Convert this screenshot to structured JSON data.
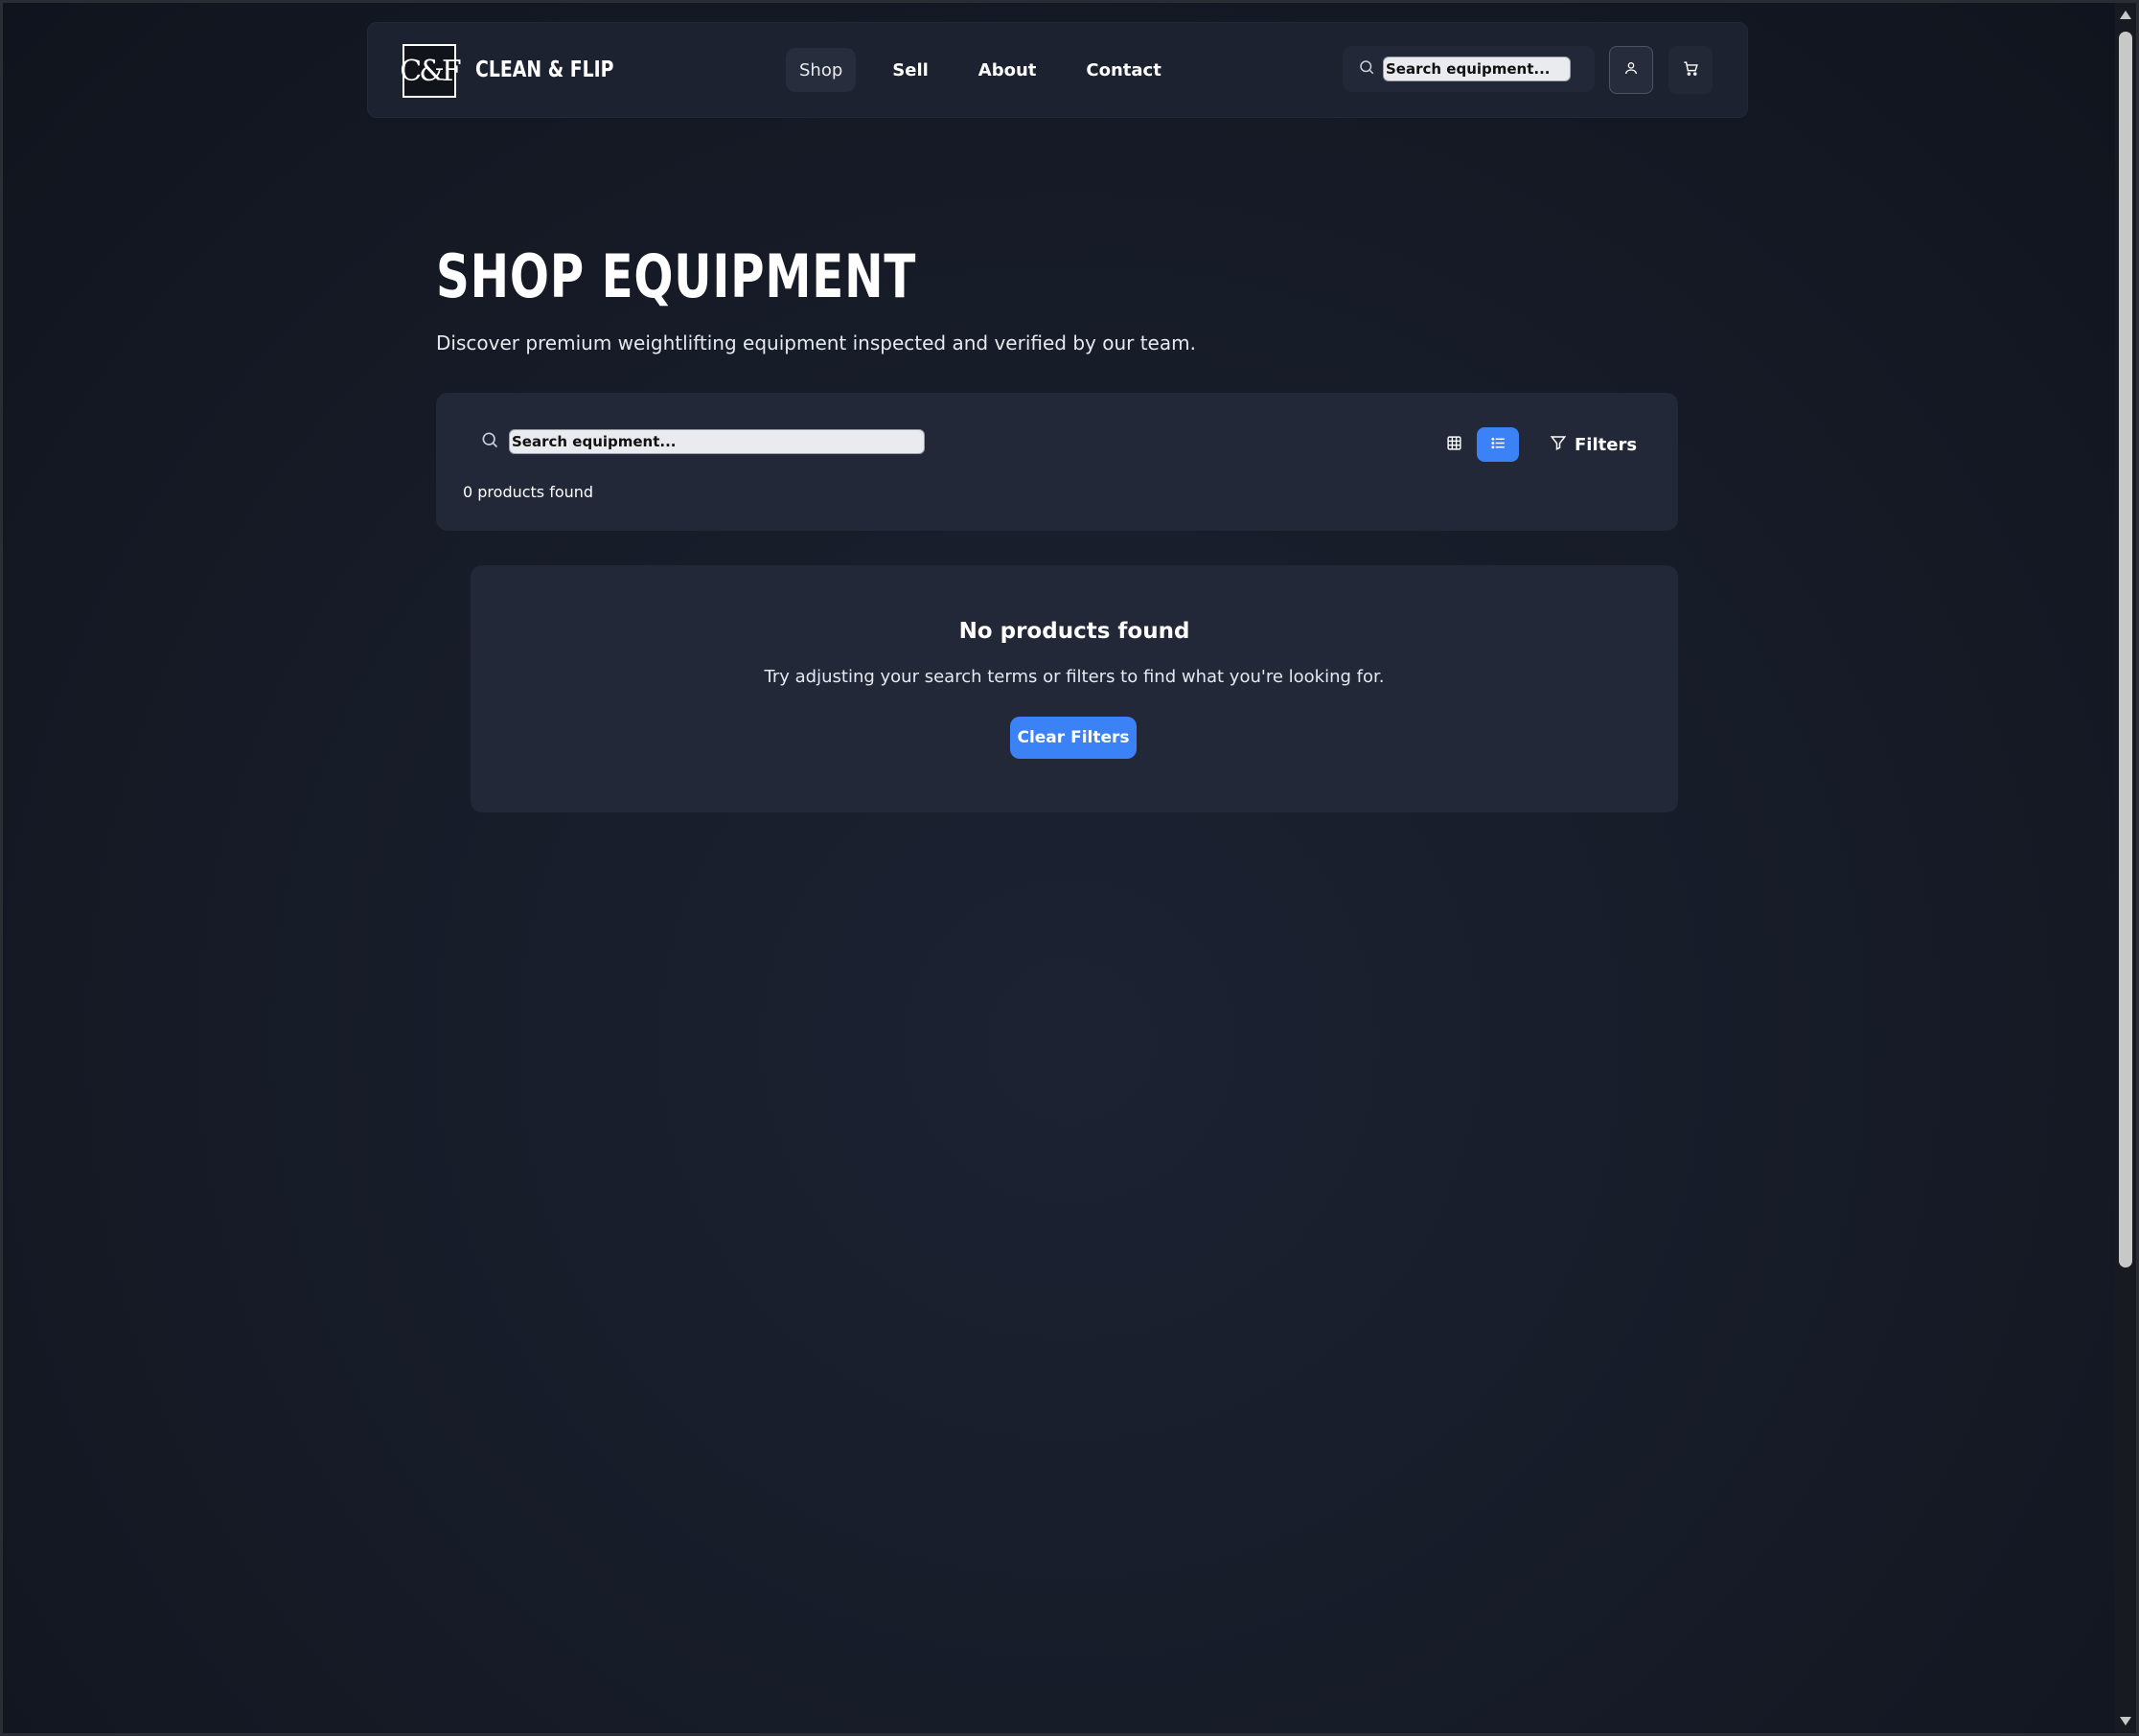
{
  "brand": {
    "logo_text": "C&F",
    "name": "CLEAN & FLIP"
  },
  "nav": {
    "items": [
      {
        "label": "Shop",
        "active": true
      },
      {
        "label": "Sell"
      },
      {
        "label": "About"
      },
      {
        "label": "Contact"
      }
    ]
  },
  "header_search": {
    "value": "Search equipment...",
    "icon": "search-icon"
  },
  "header_actions": {
    "user_icon": "user-icon",
    "cart_icon": "cart-icon"
  },
  "page": {
    "title": "SHOP EQUIPMENT",
    "subtitle": "Discover premium weightlifting equipment inspected and verified by our team."
  },
  "toolbar": {
    "search_value": "Search equipment...",
    "results_count": "0 products found",
    "view_mode": "list",
    "filters_label": "Filters"
  },
  "empty_state": {
    "title": "No products found",
    "description": "Try adjusting your search terms or filters to find what you're looking for.",
    "button_label": "Clear Filters"
  },
  "colors": {
    "accent": "#3b82f6",
    "panel": "#222838",
    "background": "#161b27"
  }
}
